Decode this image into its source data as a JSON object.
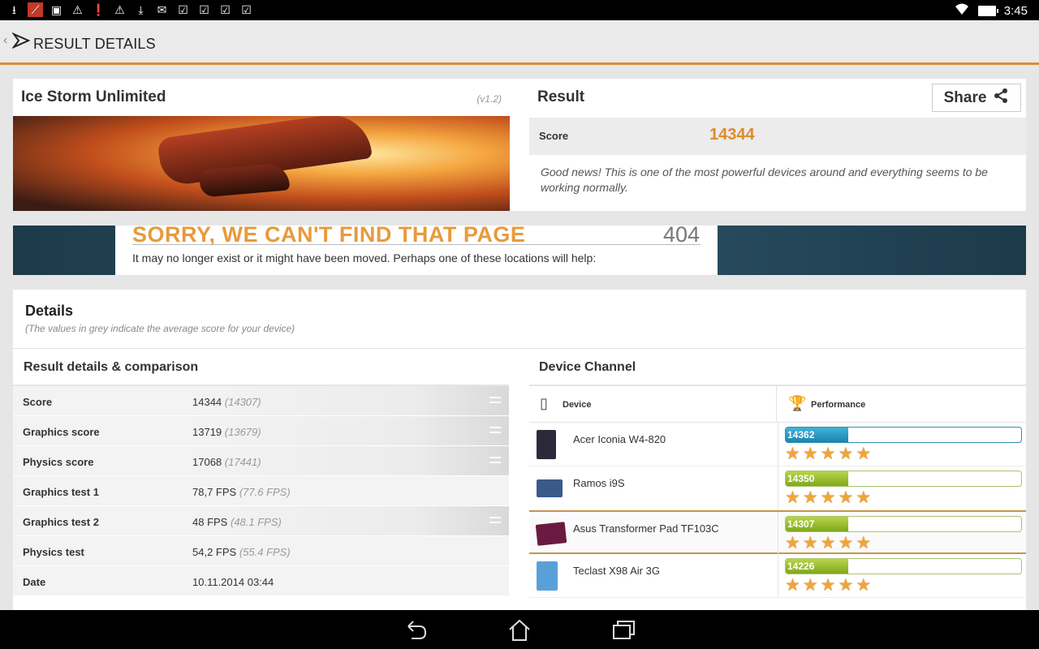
{
  "status_bar": {
    "left_icons": [
      "download-icon",
      "app-icon",
      "image-icon",
      "warning-icon",
      "alert-icon",
      "warning-icon",
      "download-icon",
      "mail-icon",
      "check-icon",
      "check-icon",
      "check-icon",
      "check-icon"
    ],
    "time": "3:45"
  },
  "appbar": {
    "title": "RESULT DETAILS"
  },
  "test": {
    "name": "Ice Storm Unlimited",
    "version": "(v1.2)"
  },
  "result": {
    "title": "Result",
    "share_label": "Share",
    "score_label": "Score",
    "score_value": "14344",
    "message": "Good news! This is one of the most powerful devices around and everything seems to be working normally."
  },
  "ad": {
    "headline": "SORRY, WE CAN'T FIND THAT PAGE",
    "code": "404",
    "sub": "It may no longer exist or it might have been moved. Perhaps one of these locations will help:"
  },
  "details": {
    "title": "Details",
    "note": "(The values in grey indicate the average score for your device)",
    "left_header": "Result details & comparison",
    "rows": [
      {
        "label": "Score",
        "value": "14344",
        "avg": "(14307)"
      },
      {
        "label": "Graphics score",
        "value": "13719",
        "avg": "(13679)"
      },
      {
        "label": "Physics score",
        "value": "17068",
        "avg": "(17441)"
      },
      {
        "label": "Graphics test 1",
        "value": "78,7 FPS",
        "avg": "(77.6 FPS)"
      },
      {
        "label": "Graphics test 2",
        "value": "48 FPS",
        "avg": "(48.1 FPS)"
      },
      {
        "label": "Physics test",
        "value": "54,2 FPS",
        "avg": "(55.4 FPS)"
      },
      {
        "label": "Date",
        "value": "10.11.2014 03:44",
        "avg": ""
      }
    ]
  },
  "channel": {
    "title": "Device Channel",
    "col_device": "Device",
    "col_performance": "Performance",
    "devices": [
      {
        "name": "Acer Iconia W4-820",
        "score": "14362"
      },
      {
        "name": "Ramos i9S",
        "score": "14350"
      },
      {
        "name": "Asus Transformer Pad TF103C",
        "score": "14307"
      },
      {
        "name": "Teclast X98 Air 3G",
        "score": "14226"
      }
    ]
  },
  "colors": {
    "accent": "#e08a2c",
    "bar_green": "#8fb82a",
    "bar_blue": "#2a9fcc"
  }
}
